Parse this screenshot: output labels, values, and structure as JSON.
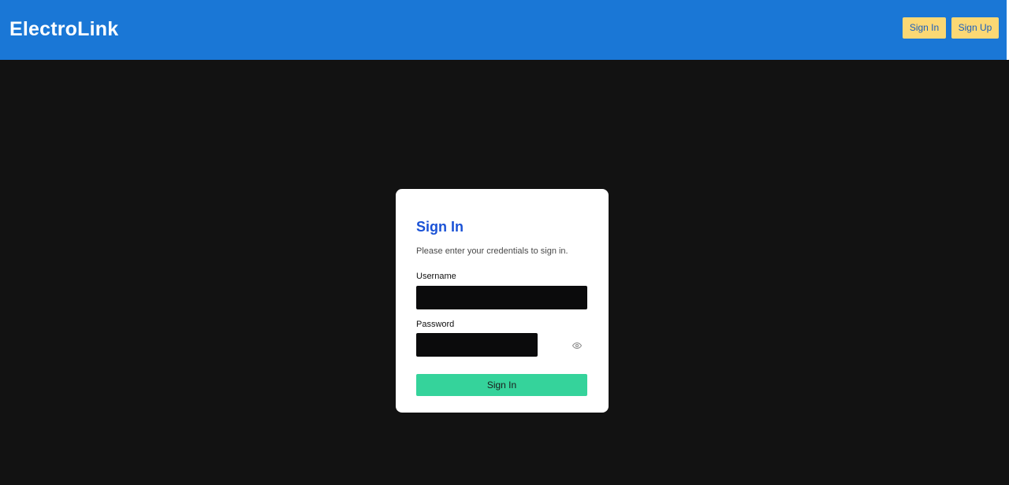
{
  "header": {
    "brand": "ElectroLink",
    "sign_in_label": "Sign In",
    "sign_up_label": "Sign Up",
    "background_color": "#1a77d6",
    "button_color": "#fbd874"
  },
  "signin_form": {
    "title": "Sign In",
    "subtitle": "Please enter your credentials to sign in.",
    "username_label": "Username",
    "username_value": "",
    "password_label": "Password",
    "password_value": "",
    "password_toggle_icon": "eye-icon",
    "submit_label": "Sign In",
    "submit_color": "#35d39b",
    "title_color": "#1a52d6"
  },
  "page": {
    "background_color": "#121212"
  }
}
